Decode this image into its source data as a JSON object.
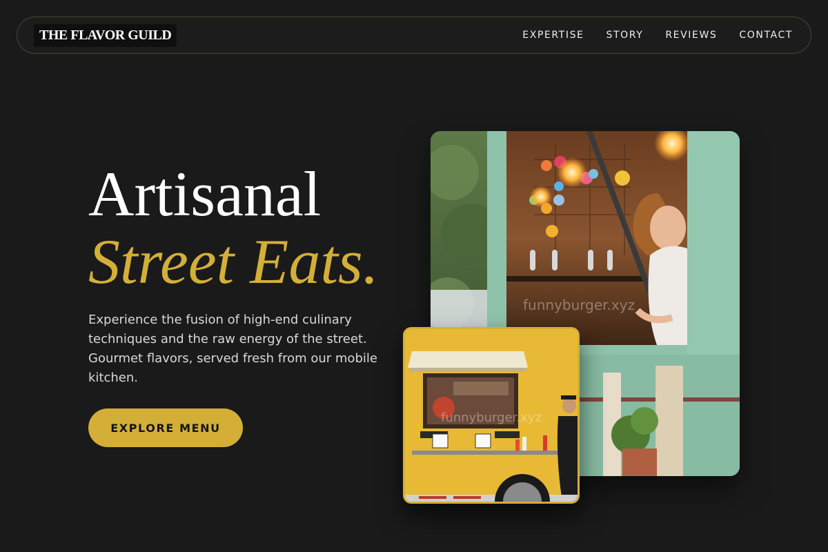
{
  "brand": {
    "name": "THE FLAVOR GUILD"
  },
  "nav": {
    "links": [
      "EXPERTISE",
      "STORY",
      "REVIEWS",
      "CONTACT"
    ]
  },
  "hero": {
    "title_line1": "Artisanal",
    "title_line2": "Street Eats.",
    "description": "Experience the fusion of high-end culinary techniques and the raw energy of the street. Gourmet flavors, served fresh from our mobile kitchen.",
    "cta_label": "EXPLORE MENU"
  },
  "images": {
    "main_watermark": "funnyburger.xyz",
    "small_watermark": "funnyburger.xyz"
  },
  "colors": {
    "accent": "#d4af37",
    "background": "#1a1a1a"
  }
}
